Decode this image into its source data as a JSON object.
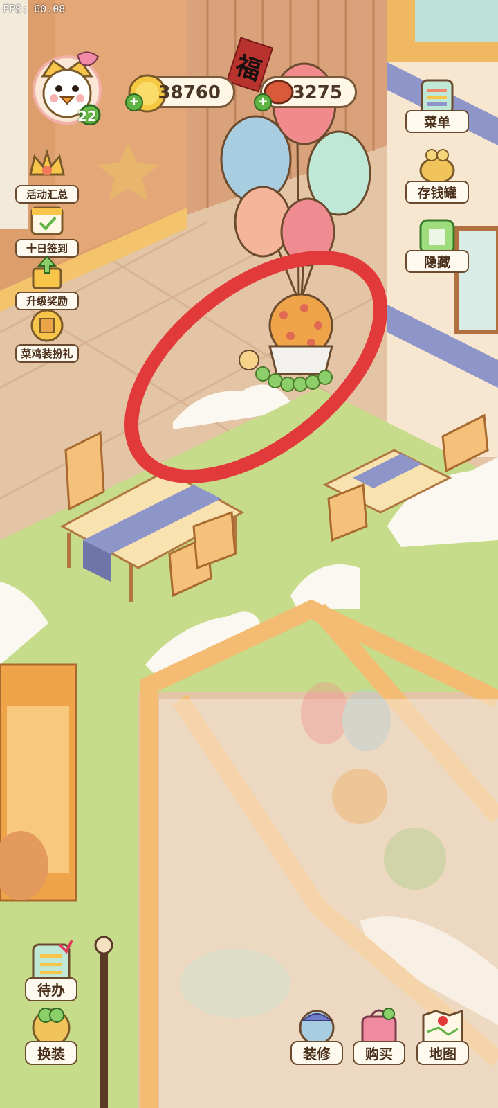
{
  "fps_label": "FPS: 60.08",
  "player": {
    "level": "22"
  },
  "currency": {
    "coins": "38760",
    "meat": "3275"
  },
  "left_menu": [
    {
      "label": "活动汇总",
      "icon": "crown-trophy-icon"
    },
    {
      "label": "十日签到",
      "icon": "calendar-check-icon"
    },
    {
      "label": "升级奖励",
      "icon": "level-up-gift-icon"
    },
    {
      "label": "菜鸡装扮礼",
      "icon": "outfit-gift-icon"
    }
  ],
  "right_menu": [
    {
      "label": "菜单",
      "icon": "menu-list-icon"
    },
    {
      "label": "存钱罐",
      "icon": "piggy-bank-icon"
    },
    {
      "label": "隐藏",
      "icon": "hide-icon"
    }
  ],
  "bottom_left": [
    {
      "label": "待办",
      "icon": "todo-clipboard-icon"
    },
    {
      "label": "换装",
      "icon": "wardrobe-icon"
    }
  ],
  "bottom_right": [
    {
      "label": "装修",
      "icon": "decorate-icon"
    },
    {
      "label": "购买",
      "icon": "shopping-bag-icon"
    },
    {
      "label": "地图",
      "icon": "map-icon"
    }
  ],
  "decor": {
    "fu_sign": "福"
  },
  "colors": {
    "floor": "#e3c4a4",
    "grass": "#c7dc8a",
    "wall": "#e6a877",
    "highlight_ring": "#e23a3a"
  }
}
